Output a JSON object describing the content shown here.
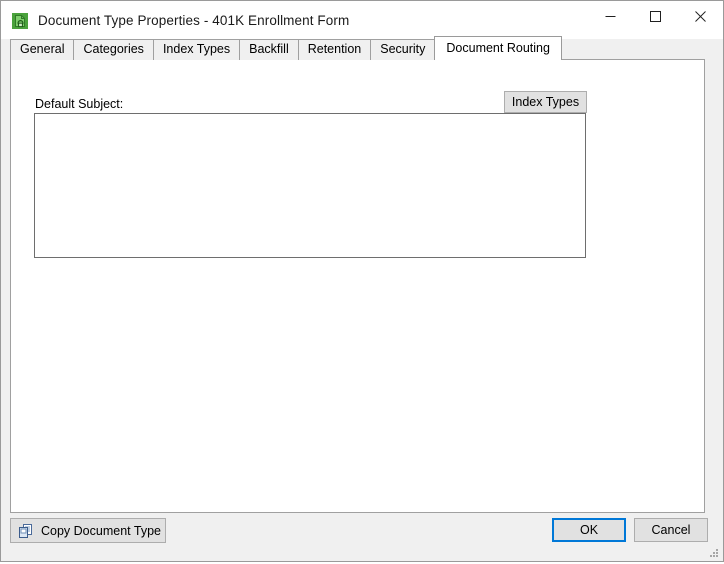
{
  "window": {
    "title": "Document Type Properties  - 401K Enrollment Form",
    "icon": "document-lock-icon",
    "controls": {
      "minimize": "minimize-icon",
      "maximize": "maximize-icon",
      "close": "close-icon"
    },
    "colors": {
      "titlebar_bg": "#ffffff",
      "dialog_bg": "#f0f0f0",
      "page_bg": "#ffffff",
      "accent_focus": "#0078d7",
      "button_face": "#e1e1e1",
      "button_border": "#adadad",
      "panel_border": "#a0a0a0",
      "field_border": "#6e6e6e",
      "text": "#000000",
      "icon_green": "#4aa23c"
    }
  },
  "tabs": [
    {
      "label": "General",
      "active": false
    },
    {
      "label": "Categories",
      "active": false
    },
    {
      "label": "Index Types",
      "active": false
    },
    {
      "label": "Backfill",
      "active": false
    },
    {
      "label": "Retention",
      "active": false
    },
    {
      "label": "Security",
      "active": false
    },
    {
      "label": "Document Routing",
      "active": true
    }
  ],
  "document_routing": {
    "default_subject_label": "Default Subject:",
    "index_types_button": "Index Types",
    "default_subject_value": "",
    "default_subject_placeholder": ""
  },
  "footer": {
    "copy_document_type": "Copy Document Type",
    "copy_icon": "copy-documents-icon",
    "ok": "OK",
    "cancel": "Cancel",
    "resize_grip": "resize-grip-icon"
  }
}
